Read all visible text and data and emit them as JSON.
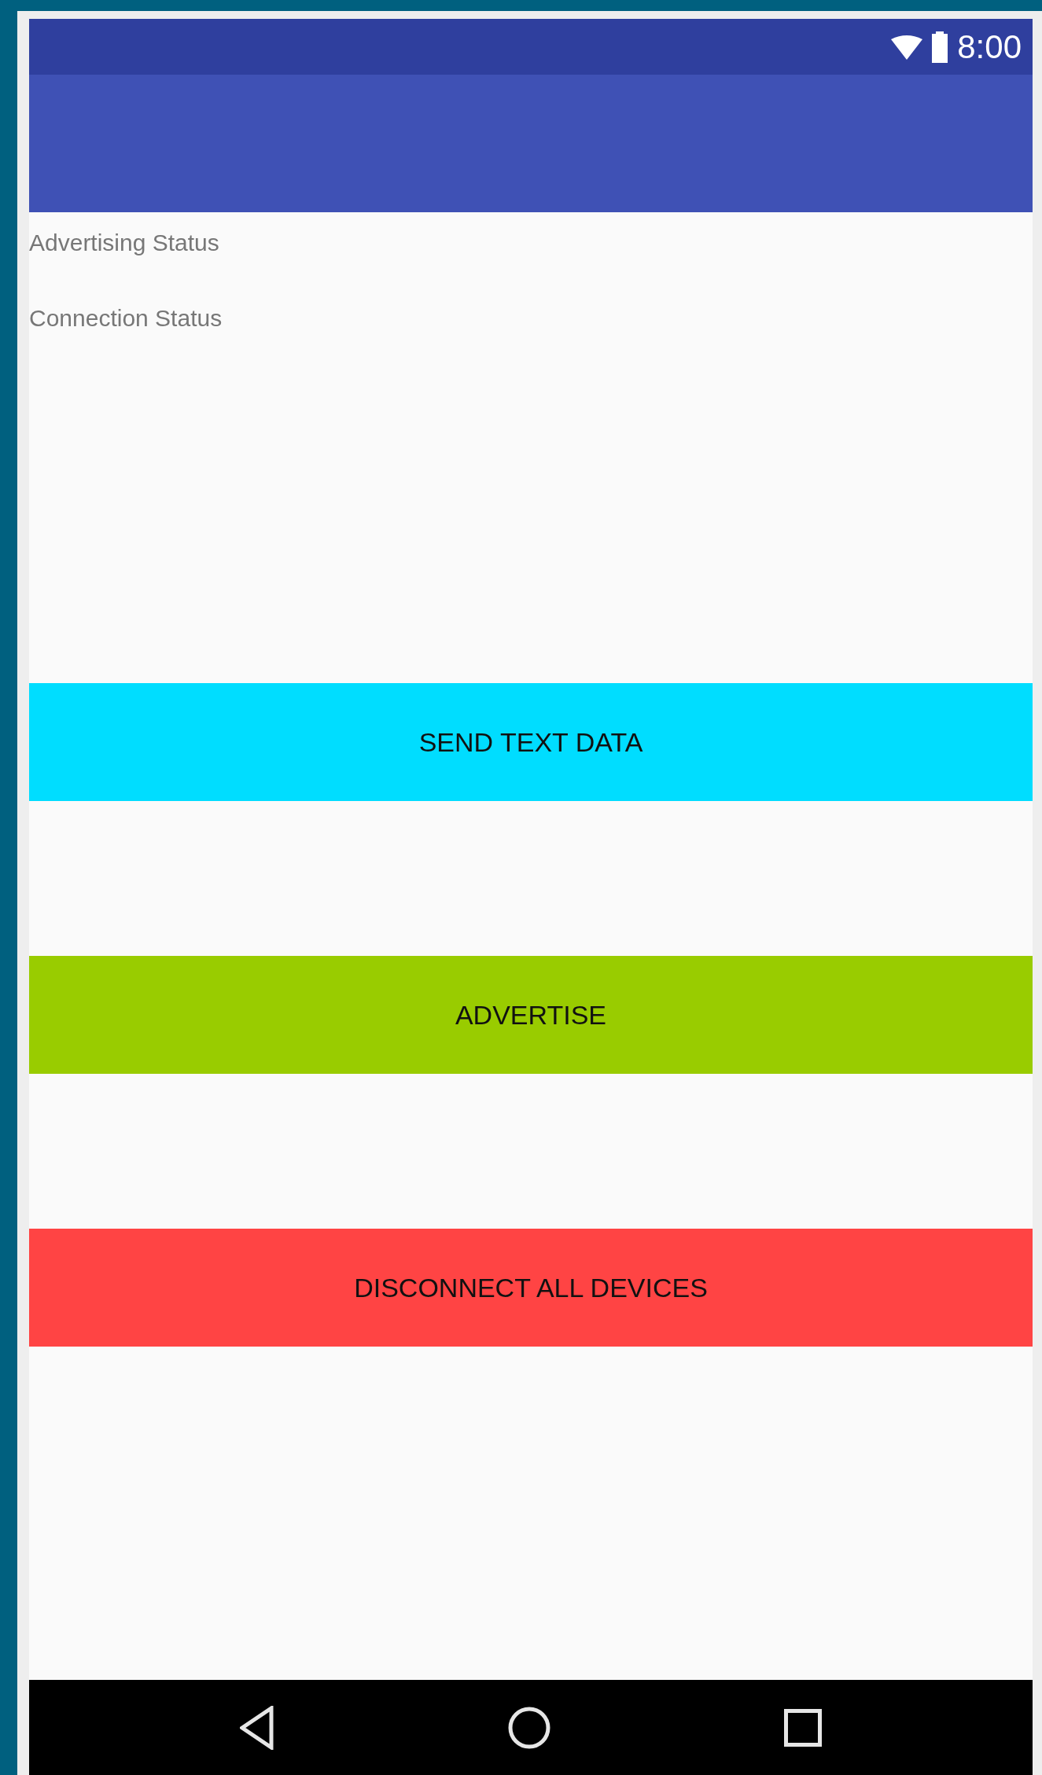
{
  "status_bar": {
    "time": "8:00"
  },
  "statuses": [
    {
      "label": "Advertising Status"
    },
    {
      "label": "Connection Status"
    }
  ],
  "buttons": [
    {
      "label": "SEND TEXT DATA",
      "color": "#00ddff"
    },
    {
      "label": "ADVERTISE",
      "color": "#99cc00"
    },
    {
      "label": "DISCONNECT ALL DEVICES",
      "color": "#ff4444"
    }
  ]
}
